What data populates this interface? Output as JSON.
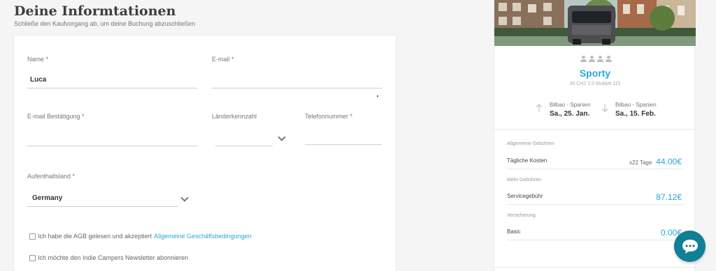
{
  "header": {
    "title": "Deine Informtationen",
    "subtitle": "Schließe den Kaufvorgang ab, um deine Buchung abzuschließen"
  },
  "form": {
    "name_label": "Name *",
    "name_value": "Luca",
    "email_label": "E-mail *",
    "email_value": "",
    "email_confirm_label": "E-mail Bestätigung *",
    "email_confirm_value": "",
    "country_code_label": "Länderkennzahl",
    "country_code_value": "",
    "phone_label": "Telefonnummer *",
    "phone_value": "",
    "residence_label": "Aufenthaltsland *",
    "residence_value": "Germany",
    "agb_text": "Ich habe die AGB gelesen und akzeptiert",
    "agb_link": "Allgemeine Geschäftsbedingungen",
    "newsletter_text": "Ich möchte den Indie Campers Newsletter abonnieren"
  },
  "summary": {
    "van_name": "Sporty",
    "van_model": "30 CH2 2.0 Multijet 115",
    "seats": 4,
    "pickup": {
      "city": "Bilbao - Spanien",
      "date": "Sa., 25. Jan."
    },
    "dropoff": {
      "city": "Bilbao - Spanien",
      "date": "Sa., 15. Feb."
    },
    "sections": [
      {
        "label": "Allgemeine Gebühren",
        "name": "Tägliche Kosten",
        "qty": "x22 Tage",
        "price": "44.00€"
      },
      {
        "label": "Mehr Gebühren",
        "name": "Servicegebühr",
        "qty": "",
        "price": "87.12€"
      },
      {
        "label": "Versicherung",
        "name": "Basic",
        "qty": "",
        "price": "0.00€"
      }
    ]
  },
  "colors": {
    "accent": "#2aa8d8",
    "chat": "#117f95"
  },
  "icons": [
    "chevron-down-icon",
    "arrow-up-icon",
    "arrow-down-icon",
    "seat-icon",
    "chat-icon"
  ]
}
